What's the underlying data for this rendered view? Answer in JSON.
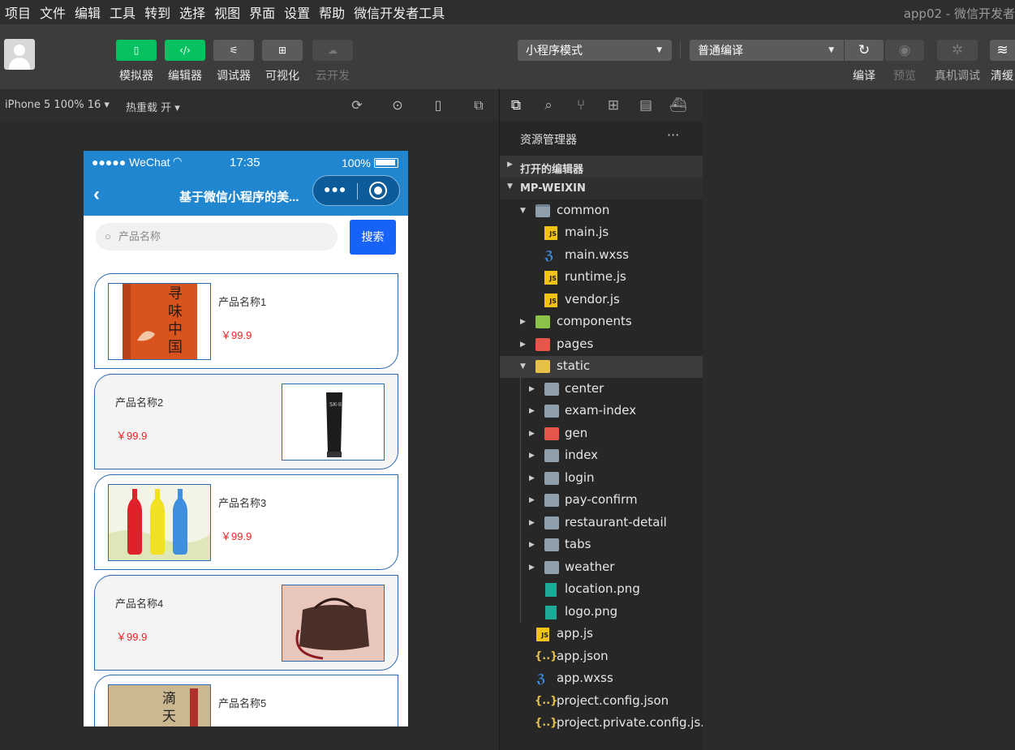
{
  "menu": [
    "项目",
    "文件",
    "编辑",
    "工具",
    "转到",
    "选择",
    "视图",
    "界面",
    "设置",
    "帮助",
    "微信开发者工具"
  ],
  "window_title": "app02 - 微信开发者",
  "toolbar": {
    "buttons": [
      {
        "label": "模拟器",
        "icon": "phone-icon",
        "glyph": "▯"
      },
      {
        "label": "编辑器",
        "icon": "code-icon",
        "glyph": "‹/›"
      },
      {
        "label": "调试器",
        "icon": "debug-sliders-icon",
        "glyph": "⚟"
      },
      {
        "label": "可视化",
        "icon": "layout-icon",
        "glyph": "⊞"
      },
      {
        "label": "云开发",
        "icon": "cloud-icon",
        "glyph": "☁"
      }
    ],
    "mode_select": "小程序模式",
    "compile_select": "普通编译",
    "actions": [
      {
        "label": "编译",
        "icon": "refresh-icon",
        "glyph": "↻"
      },
      {
        "label": "预览",
        "icon": "eye-icon",
        "glyph": "◉"
      },
      {
        "label": "真机调试",
        "icon": "bug-icon",
        "glyph": "✲"
      },
      {
        "label": "清缓",
        "icon": "layers-icon",
        "glyph": "≋"
      }
    ]
  },
  "simulator": {
    "device": "iPhone 5 100% 16 ▾",
    "hot_reload": "热重载 开 ▾"
  },
  "phone": {
    "status_left": "●●●●● WeChat",
    "time": "17:35",
    "battery": "100%",
    "nav_title": "基于微信小程序的美...",
    "search_placeholder": "产品名称",
    "search_button": "搜索",
    "products": [
      {
        "name": "产品名称1",
        "price": "￥99.9"
      },
      {
        "name": "产品名称2",
        "price": "￥99.9"
      },
      {
        "name": "产品名称3",
        "price": "￥99.9"
      },
      {
        "name": "产品名称4",
        "price": "￥99.9"
      },
      {
        "name": "产品名称5",
        "price": ""
      }
    ]
  },
  "explorer": {
    "title": "资源管理器",
    "more": "···",
    "open_editors": "打开的编辑器",
    "root": "MP-WEIXIN",
    "tree": [
      "common",
      "main.js",
      "main.wxss",
      "runtime.js",
      "vendor.js",
      "components",
      "pages",
      "static",
      "center",
      "exam-index",
      "gen",
      "index",
      "login",
      "pay-confirm",
      "restaurant-detail",
      "tabs",
      "weather",
      "location.png",
      "logo.png",
      "app.js",
      "app.json",
      "app.wxss",
      "project.config.json",
      "project.private.config.js..."
    ]
  },
  "colors": {
    "accent_green": "#07c160",
    "nav_blue": "#1f86cf",
    "search_blue": "#1762f7",
    "price_red": "#ee2222"
  }
}
